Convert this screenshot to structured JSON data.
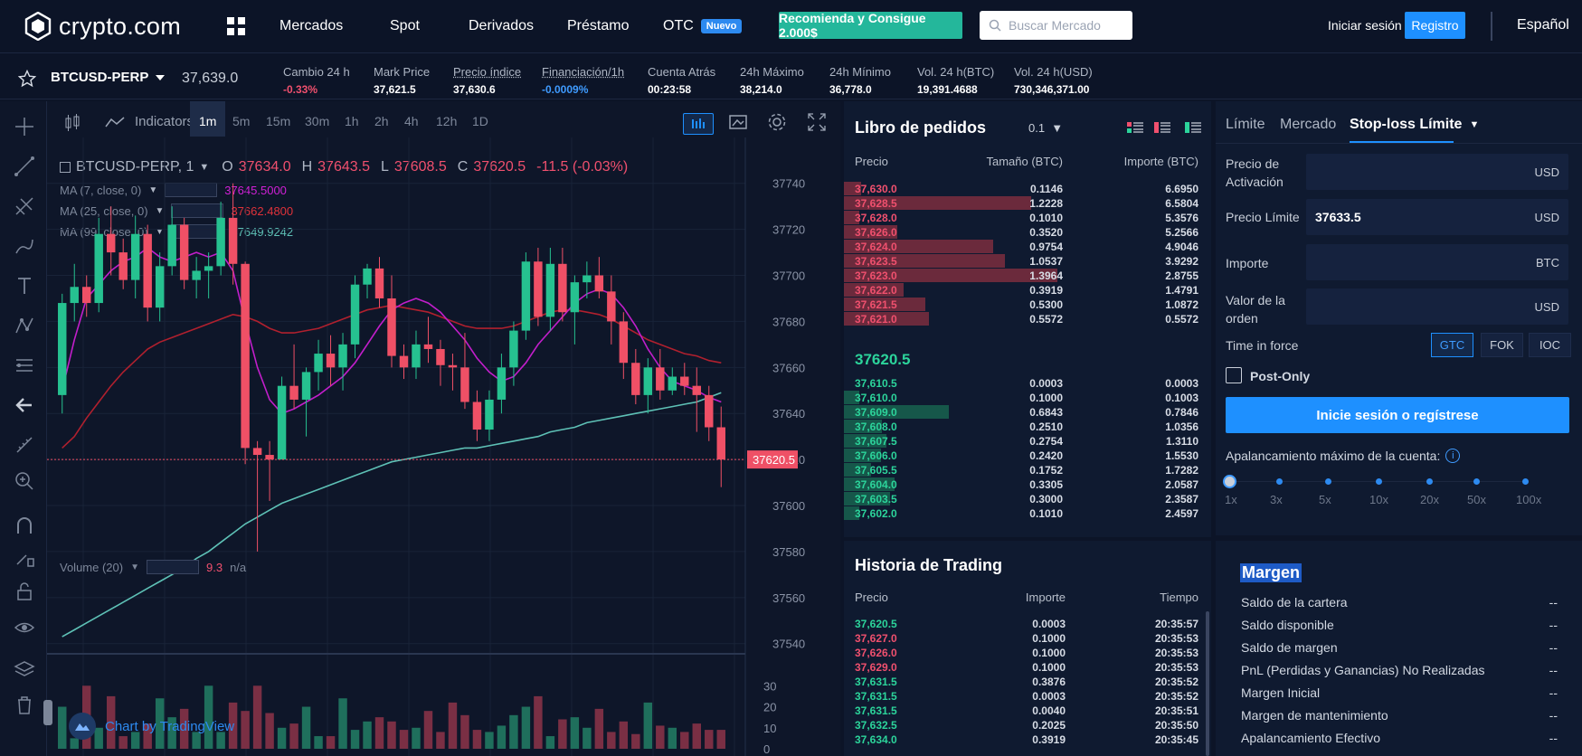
{
  "nav": {
    "logo_text": "crypto.com",
    "items": [
      "Mercados",
      "Spot",
      "Derivados",
      "Préstamo",
      "OTC"
    ],
    "otc_badge": "Nuevo",
    "promo_button": "Recomienda y Consigue 2.000$",
    "search_placeholder": "Buscar Mercado",
    "login": "Iniciar sesión",
    "register": "Registro",
    "language": "Español"
  },
  "ticker": {
    "symbol": "BTCUSD-PERP",
    "price": "37,639.0",
    "stats": [
      {
        "label": "Cambio 24 h",
        "value": "-0.33%"
      },
      {
        "label": "Mark Price",
        "value": "37,621.5"
      },
      {
        "label": "Precio índice",
        "value": "37,630.6"
      },
      {
        "label": "Financiación/1h",
        "value": "-0.0009%"
      },
      {
        "label": "Cuenta Atrás",
        "value": "00:23:58"
      },
      {
        "label": "24h Máximo",
        "value": "38,214.0"
      },
      {
        "label": "24h Mínimo",
        "value": "36,778.0"
      },
      {
        "label": "Vol. 24 h(BTC)",
        "value": "19,391.4688"
      },
      {
        "label": "Vol. 24 h(USD)",
        "value": "730,346,371.00"
      }
    ]
  },
  "chart": {
    "indicators_label": "Indicators",
    "timeframes": [
      "1m",
      "5m",
      "15m",
      "30m",
      "1h",
      "2h",
      "4h",
      "12h",
      "1D"
    ],
    "active_timeframe": "1m",
    "legend_symbol": "BTCUSD-PERP, 1",
    "ohlc": {
      "o": "37634.0",
      "h": "37643.5",
      "l": "37608.5",
      "c": "37620.5",
      "chg": "-11.5 (-0.03%)"
    },
    "ma_lines": [
      {
        "label": "MA (7, close, 0)",
        "value": "37645.5000",
        "color": "#d020d6"
      },
      {
        "label": "MA (25, close, 0)",
        "value": "37662.4800",
        "color": "#e0323a"
      },
      {
        "label": "MA (99, close, 0)",
        "value": "37649.9242",
        "color": "#5ec1b6"
      }
    ],
    "volume_label": "Volume (20)",
    "volume_value": "9.3",
    "volume_na": "n/a",
    "current_price_tag": "37620.5",
    "tradingview": "Chart by TradingView"
  },
  "chart_data": {
    "type": "candlestick",
    "y_ticks": [
      37740,
      37720,
      37700,
      37680,
      37660,
      37640,
      37620,
      37600,
      37580,
      37560,
      37540
    ],
    "y_range": [
      37534,
      37756
    ],
    "volume_ticks": [
      30,
      20,
      10,
      0
    ],
    "volume_range": [
      0,
      34
    ],
    "candles": [
      [
        37648,
        37692,
        37640,
        37688
      ],
      [
        37688,
        37705,
        37680,
        37695
      ],
      [
        37695,
        37700,
        37682,
        37688
      ],
      [
        37688,
        37725,
        37684,
        37718
      ],
      [
        37718,
        37730,
        37700,
        37710
      ],
      [
        37710,
        37716,
        37694,
        37698
      ],
      [
        37698,
        37726,
        37690,
        37718
      ],
      [
        37718,
        37722,
        37680,
        37686
      ],
      [
        37686,
        37710,
        37680,
        37704
      ],
      [
        37704,
        37730,
        37700,
        37722
      ],
      [
        37722,
        37725,
        37694,
        37698
      ],
      [
        37698,
        37708,
        37690,
        37702
      ],
      [
        37702,
        37710,
        37690,
        37704
      ],
      [
        37704,
        37732,
        37700,
        37725
      ],
      [
        37725,
        37740,
        37696,
        37705
      ],
      [
        37705,
        37706,
        37618,
        37625
      ],
      [
        37625,
        37628,
        37580,
        37622
      ],
      [
        37622,
        37628,
        37602,
        37620
      ],
      [
        37620,
        37656,
        37620,
        37652
      ],
      [
        37652,
        37670,
        37642,
        37646
      ],
      [
        37646,
        37660,
        37630,
        37658
      ],
      [
        37658,
        37672,
        37650,
        37666
      ],
      [
        37666,
        37674,
        37652,
        37660
      ],
      [
        37660,
        37675,
        37650,
        37670
      ],
      [
        37670,
        37700,
        37664,
        37696
      ],
      [
        37696,
        37705,
        37690,
        37703
      ],
      [
        37703,
        37708,
        37686,
        37690
      ],
      [
        37690,
        37700,
        37660,
        37665
      ],
      [
        37665,
        37670,
        37655,
        37660
      ],
      [
        37660,
        37676,
        37655,
        37670
      ],
      [
        37670,
        37682,
        37662,
        37668
      ],
      [
        37668,
        37672,
        37652,
        37661
      ],
      [
        37661,
        37666,
        37650,
        37660
      ],
      [
        37660,
        37675,
        37642,
        37645
      ],
      [
        37645,
        37650,
        37628,
        37633
      ],
      [
        37633,
        37650,
        37628,
        37646
      ],
      [
        37646,
        37666,
        37640,
        37660
      ],
      [
        37660,
        37680,
        37652,
        37676
      ],
      [
        37676,
        37710,
        37672,
        37706
      ],
      [
        37706,
        37712,
        37678,
        37682
      ],
      [
        37682,
        37712,
        37676,
        37705
      ],
      [
        37705,
        37712,
        37680,
        37684
      ],
      [
        37684,
        37700,
        37670,
        37697
      ],
      [
        37697,
        37706,
        37690,
        37700
      ],
      [
        37700,
        37708,
        37690,
        37693
      ],
      [
        37693,
        37700,
        37670,
        37680
      ],
      [
        37680,
        37684,
        37655,
        37662
      ],
      [
        37662,
        37668,
        37644,
        37648
      ],
      [
        37648,
        37664,
        37640,
        37660
      ],
      [
        37660,
        37668,
        37646,
        37650
      ],
      [
        37650,
        37660,
        37648,
        37656
      ],
      [
        37656,
        37662,
        37648,
        37652
      ],
      [
        37652,
        37660,
        37632,
        37648
      ],
      [
        37648,
        37652,
        37628,
        37634
      ],
      [
        37634,
        37643,
        37608,
        37620
      ]
    ],
    "volumes": [
      20,
      5,
      30,
      10,
      25,
      6,
      8,
      12,
      24,
      15,
      19,
      8,
      30,
      8,
      22,
      18,
      30,
      17,
      10,
      12,
      20,
      6,
      6,
      24,
      9,
      13,
      15,
      13,
      9,
      10,
      18,
      8,
      22,
      16,
      9,
      8,
      11,
      16,
      20,
      25,
      6,
      14,
      15,
      10,
      19,
      8,
      13,
      7,
      22,
      11,
      10,
      8,
      12,
      9,
      9
    ],
    "ma7": [
      37650,
      37672,
      37690,
      37696,
      37702,
      37706,
      37708,
      37712,
      37708,
      37706,
      37708,
      37710,
      37708,
      37710,
      37702,
      37680,
      37660,
      37646,
      37640,
      37642,
      37645,
      37648,
      37652,
      37656,
      37662,
      37670,
      37678,
      37685,
      37688,
      37690,
      37688,
      37684,
      37678,
      37672,
      37664,
      37658,
      37654,
      37656,
      37662,
      37670,
      37676,
      37682,
      37688,
      37692,
      37694,
      37692,
      37686,
      37678,
      37668,
      37660,
      37654,
      37652,
      37650,
      37647,
      37645
    ],
    "ma25": [
      37625,
      37630,
      37638,
      37645,
      37652,
      37658,
      37663,
      37668,
      37671,
      37673,
      37675,
      37677,
      37679,
      37681,
      37683,
      37682,
      37680,
      37677,
      37675,
      37675,
      37676,
      37677,
      37679,
      37681,
      37683,
      37685,
      37686,
      37687,
      37686,
      37685,
      37684,
      37682,
      37680,
      37678,
      37677,
      37677,
      37677,
      37678,
      37680,
      37682,
      37684,
      37685,
      37685,
      37684,
      37683,
      37681,
      37678,
      37675,
      37672,
      37670,
      37668,
      37666,
      37665,
      37663,
      37662
    ],
    "ma99": [
      37543,
      37546,
      37549,
      37552,
      37555,
      37558,
      37561,
      37564,
      37567,
      37570,
      37573,
      37577,
      37580,
      37584,
      37588,
      37592,
      37595,
      37598,
      37601,
      37603,
      37605,
      37607,
      37609,
      37611,
      37613,
      37615,
      37617,
      37619,
      37620,
      37621,
      37622,
      37623,
      37624,
      37625,
      37625,
      37626,
      37627,
      37628,
      37629,
      37630,
      37632,
      37633,
      37634,
      37636,
      37637,
      37638,
      37639,
      37640,
      37641,
      37642,
      37643,
      37644,
      37645,
      37647,
      37649
    ]
  },
  "orderbook": {
    "title": "Libro de pedidos",
    "precision": "0.1",
    "headers": [
      "Precio",
      "Tamaño (BTC)",
      "Importe (BTC)"
    ],
    "asks": [
      [
        "37,630.0",
        "0.1146",
        "6.6950",
        0.1146
      ],
      [
        "37,628.5",
        "1.2228",
        "6.5804",
        1.2228
      ],
      [
        "37,628.0",
        "0.1010",
        "5.3576",
        0.101
      ],
      [
        "37,626.0",
        "0.3520",
        "5.2566",
        0.352
      ],
      [
        "37,624.0",
        "0.9754",
        "4.9046",
        0.9754
      ],
      [
        "37,623.5",
        "1.0537",
        "3.9292",
        1.0537
      ],
      [
        "37,623.0",
        "1.3964",
        "2.8755",
        1.3964
      ],
      [
        "37,622.0",
        "0.3919",
        "1.4791",
        0.3919
      ],
      [
        "37,621.5",
        "0.5300",
        "1.0872",
        0.53
      ],
      [
        "37,621.0",
        "0.5572",
        "0.5572",
        0.5572
      ]
    ],
    "mid_price": "37620.5",
    "bids": [
      [
        "37,610.5",
        "0.0003",
        "0.0003",
        0.0003
      ],
      [
        "37,610.0",
        "0.1000",
        "0.1003",
        0.1
      ],
      [
        "37,609.0",
        "0.6843",
        "0.7846",
        0.6843
      ],
      [
        "37,608.0",
        "0.2510",
        "1.0356",
        0.251
      ],
      [
        "37,607.5",
        "0.2754",
        "1.3110",
        0.2754
      ],
      [
        "37,606.0",
        "0.2420",
        "1.5530",
        0.242
      ],
      [
        "37,605.5",
        "0.1752",
        "1.7282",
        0.1752
      ],
      [
        "37,604.0",
        "0.3305",
        "2.0587",
        0.3305
      ],
      [
        "37,603.5",
        "0.3000",
        "2.3587",
        0.3
      ],
      [
        "37,602.0",
        "0.1010",
        "2.4597",
        0.101
      ]
    ]
  },
  "trades": {
    "title": "Historia de Trading",
    "headers": [
      "Precio",
      "Importe",
      "Tiempo"
    ],
    "rows": [
      [
        "37,620.5",
        "0.0003",
        "20:35:57",
        "buy"
      ],
      [
        "37,627.0",
        "0.1000",
        "20:35:53",
        "sell"
      ],
      [
        "37,626.0",
        "0.1000",
        "20:35:53",
        "sell"
      ],
      [
        "37,629.0",
        "0.1000",
        "20:35:53",
        "sell"
      ],
      [
        "37,631.5",
        "0.3876",
        "20:35:52",
        "buy"
      ],
      [
        "37,631.5",
        "0.0003",
        "20:35:52",
        "buy"
      ],
      [
        "37,631.5",
        "0.0040",
        "20:35:51",
        "buy"
      ],
      [
        "37,632.5",
        "0.2025",
        "20:35:50",
        "buy"
      ],
      [
        "37,634.0",
        "0.3919",
        "20:35:45",
        "buy"
      ]
    ]
  },
  "orderform": {
    "tabs": [
      "Límite",
      "Mercado",
      "Stop-loss Límite"
    ],
    "active_tab": "Stop-loss Límite",
    "fields": [
      {
        "label": "Precio de Activación",
        "value": "",
        "unit": "USD"
      },
      {
        "label": "Precio Límite",
        "value": "37633.5",
        "unit": "USD"
      },
      {
        "label": "Importe",
        "value": "",
        "unit": "BTC"
      },
      {
        "label": "Valor de la orden",
        "value": "",
        "unit": "USD"
      }
    ],
    "tif_label": "Time in force",
    "tif_options": [
      "GTC",
      "FOK",
      "IOC"
    ],
    "tif_selected": "GTC",
    "post_only": "Post-Only",
    "submit": "Inicie sesión o regístrese",
    "leverage_label": "Apalancamiento máximo de la cuenta:",
    "leverage_steps": [
      "1x",
      "3x",
      "5x",
      "10x",
      "20x",
      "50x",
      "100x"
    ]
  },
  "margin": {
    "title": "Margen",
    "rows": [
      {
        "label": "Saldo de la cartera",
        "value": "--"
      },
      {
        "label": "Saldo disponible",
        "value": "--"
      },
      {
        "label": "Saldo de margen",
        "value": "--"
      },
      {
        "label": "PnL (Perdidas y Ganancias) No Realizadas",
        "value": "--"
      },
      {
        "label": "Margen Inicial",
        "value": "--"
      },
      {
        "label": "Margen de mantenimiento",
        "value": "--"
      },
      {
        "label": "Apalancamiento Efectivo",
        "value": "--"
      }
    ]
  },
  "colors": {
    "up": "#2cd49b",
    "down": "#f0506e",
    "accent": "#1e90ff",
    "bg": "#0c1427"
  }
}
